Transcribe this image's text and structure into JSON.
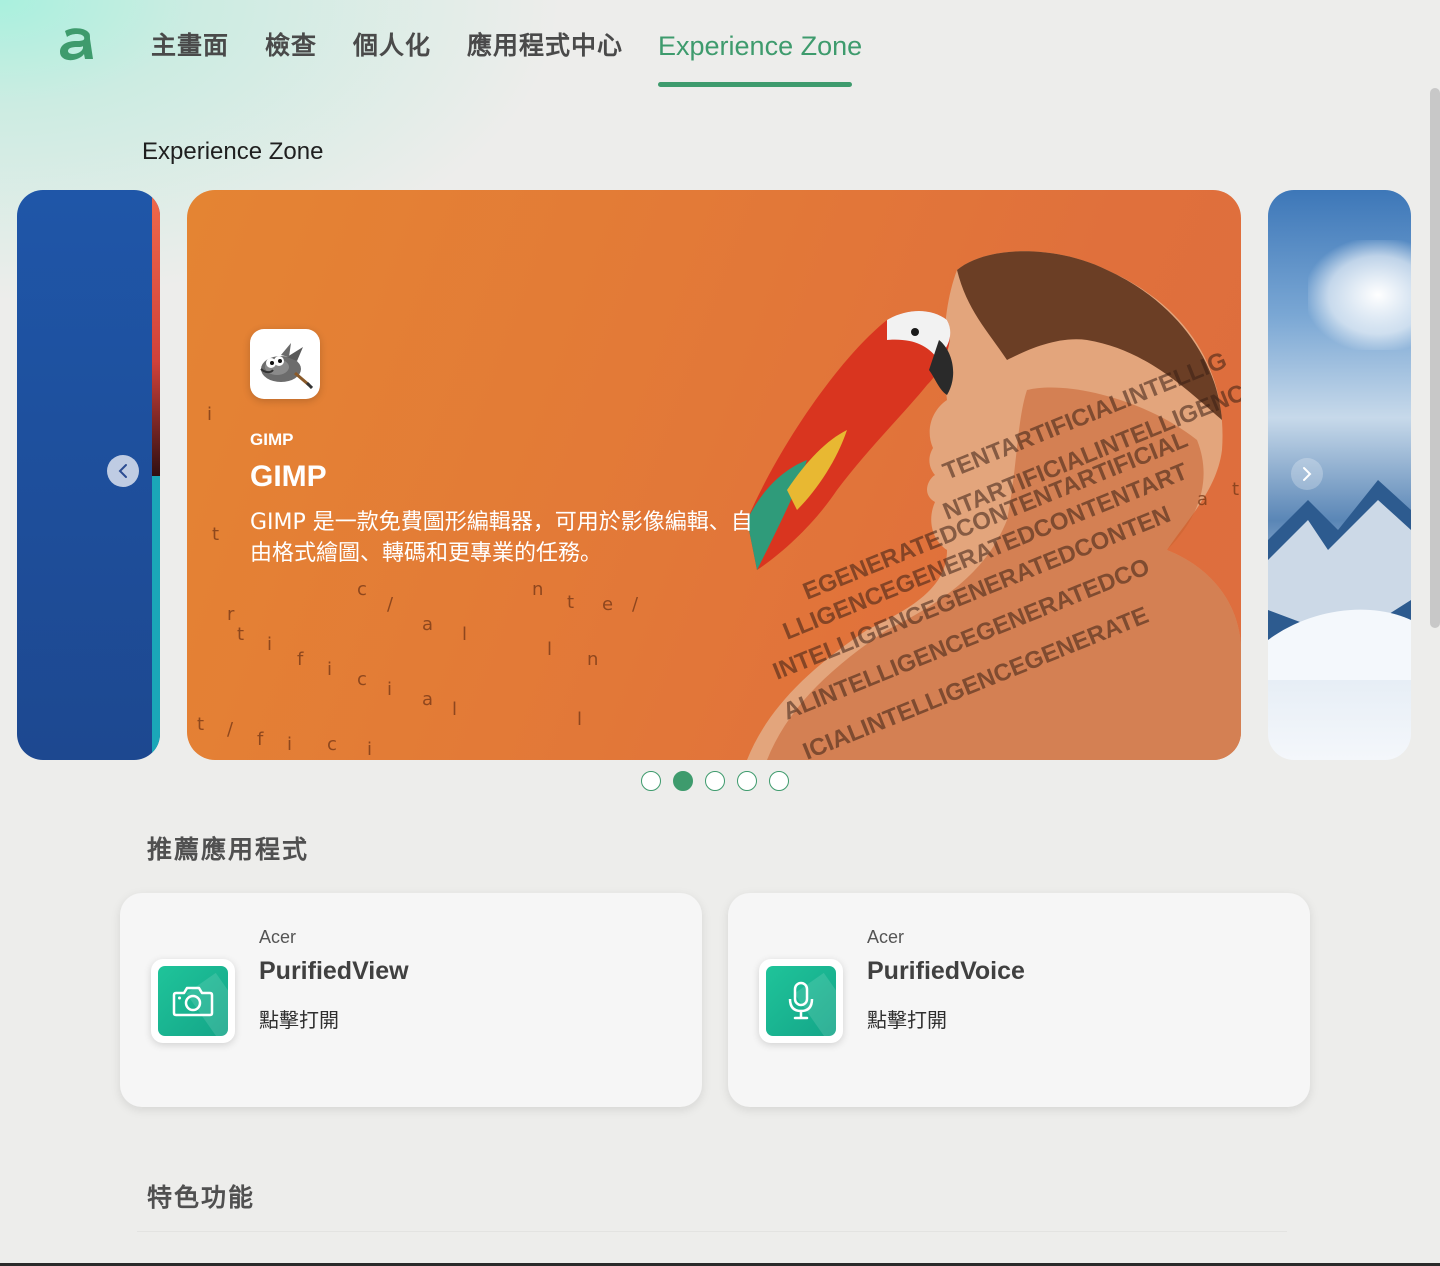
{
  "nav": {
    "tabs": [
      {
        "label": "主畫面"
      },
      {
        "label": "檢查"
      },
      {
        "label": "個人化"
      },
      {
        "label": "應用程式中心"
      },
      {
        "label": "Experience Zone"
      }
    ],
    "active_tab": "Experience Zone",
    "accent_color": "#3e9b6d"
  },
  "page": {
    "section_title": "Experience Zone"
  },
  "carousel": {
    "slide": {
      "icon": "gimp-wilber-icon",
      "tag": "GIMP",
      "title": "GIMP",
      "description": "GIMP 是一款免費圖形編輯器，可用於影像編輯、自由格式繪圖、轉碼和更專業的任務。",
      "background_color": "#e37a37"
    },
    "dots_total": 5,
    "active_dot": 2
  },
  "recommended": {
    "title": "推薦應用程式",
    "apps": [
      {
        "vendor": "Acer",
        "name": "PurifiedView",
        "action": "點擊打開",
        "icon": "camera-icon"
      },
      {
        "vendor": "Acer",
        "name": "PurifiedVoice",
        "action": "點擊打開",
        "icon": "microphone-icon"
      }
    ]
  },
  "features": {
    "title": "特色功能"
  }
}
